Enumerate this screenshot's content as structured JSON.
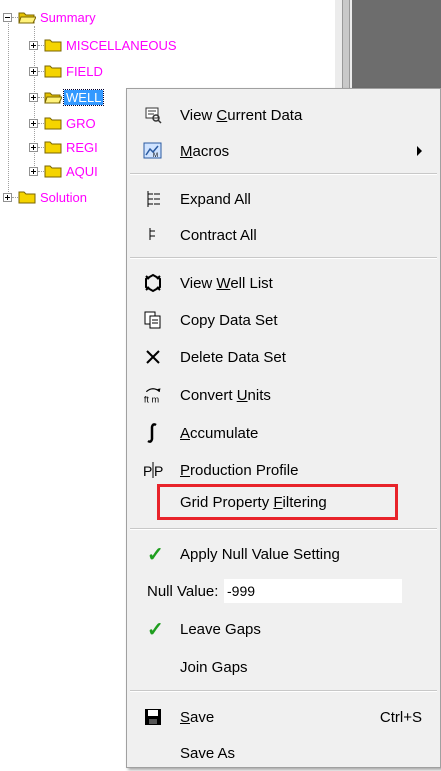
{
  "tree": {
    "root": {
      "label": "Summary"
    },
    "children": [
      {
        "label": "MISCELLANEOUS"
      },
      {
        "label": "FIELD"
      },
      {
        "label": "WELL",
        "selected": true
      },
      {
        "label": "GRO"
      },
      {
        "label": "REGI"
      },
      {
        "label": "AQUI"
      }
    ],
    "solution": {
      "label": "Solution"
    }
  },
  "context_menu": {
    "items": [
      {
        "id": "view_current_data",
        "pre": "View ",
        "u": "C",
        "post": "urrent Data",
        "icon": "view-data-icon"
      },
      {
        "id": "macros",
        "pre": "",
        "u": "M",
        "post": "acros",
        "icon": "macros-icon",
        "submenu": true
      },
      {
        "id": "expand_all",
        "pre": "Expand All",
        "u": "",
        "post": "",
        "icon": "expand-tree-icon"
      },
      {
        "id": "contract_all",
        "pre": "Contract All",
        "u": "",
        "post": "",
        "icon": "contract-tree-icon"
      },
      {
        "id": "view_well_list",
        "pre": "View ",
        "u": "W",
        "post": "ell List",
        "icon": "well-list-icon"
      },
      {
        "id": "copy_data_set",
        "pre": "Copy Data Set",
        "u": "",
        "post": "",
        "icon": "copy-icon"
      },
      {
        "id": "delete_data_set",
        "pre": "Delete Data Set",
        "u": "",
        "post": "",
        "icon": "delete-icon"
      },
      {
        "id": "convert_units",
        "pre": "Convert ",
        "u": "U",
        "post": "nits",
        "icon": "convert-units-icon"
      },
      {
        "id": "accumulate",
        "pre": "",
        "u": "A",
        "post": "ccumulate",
        "icon": "integral-icon"
      },
      {
        "id": "production_profile",
        "pre": "",
        "u": "P",
        "post": "roduction Profile",
        "icon": "production-profile-icon"
      },
      {
        "id": "grid_property_filtering",
        "pre": "Grid Property ",
        "u": "F",
        "post": "iltering",
        "icon": ""
      },
      {
        "id": "apply_null_value_setting",
        "pre": "Apply Null Value Setting",
        "u": "",
        "post": "",
        "checked": true
      },
      {
        "id": "leave_gaps",
        "pre": "Leave Gaps",
        "u": "",
        "post": "",
        "checked": true
      },
      {
        "id": "join_gaps",
        "pre": "Join Gaps",
        "u": "",
        "post": ""
      },
      {
        "id": "save",
        "pre": "",
        "u": "S",
        "post": "ave",
        "icon": "save-icon",
        "shortcut": "Ctrl+S"
      },
      {
        "id": "save_as",
        "pre": "Save As",
        "u": "",
        "post": ""
      }
    ],
    "null_value": {
      "label": "Null Value:",
      "value": "-999"
    }
  },
  "colors": {
    "tree_text": "#ff00ff",
    "selection": "#3399ff",
    "highlight_box": "#e8232a",
    "check": "#1f9e1f"
  },
  "icons": {
    "folder": "folder-icon",
    "check": "✓",
    "expand_all_glyph": "⊟",
    "contract_all_glyph": "ϵ",
    "convert_units_glyph": "ft m",
    "accumulate_glyph": "∫",
    "production_profile_glyph": "PP",
    "delete_glyph": "✕"
  }
}
